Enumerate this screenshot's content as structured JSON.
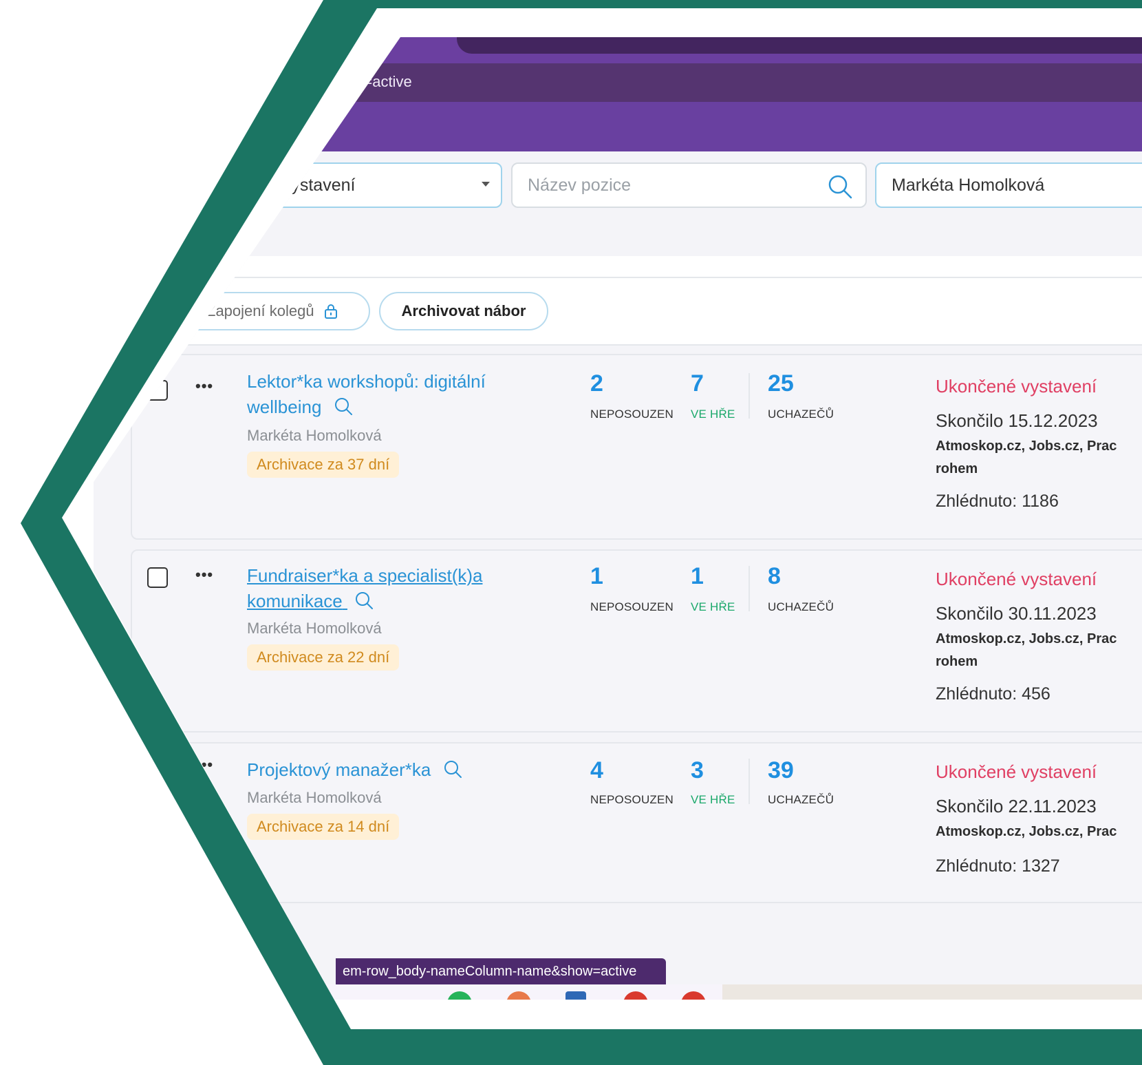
{
  "browser": {
    "url_fragment": "how=active",
    "status_url": "em-row_body-nameColumn-name&show=active"
  },
  "filters": {
    "publication_select": "a vystavení",
    "position_placeholder": "Název pozice",
    "owner_value": "Markéta Homolková"
  },
  "actions": {
    "colleagues_label": "Zapojení kolegů",
    "archive_label": "Archivovat nábor"
  },
  "stat_labels": {
    "unreviewed": "NEPOSOUZEN",
    "in_game": "VE HŘE",
    "applicants": "UCHAZEČŮ"
  },
  "rows": [
    {
      "title_line1": "Lektor*ka workshopů: digitální",
      "title_line2": "wellbeing",
      "owner": "Markéta Homolková",
      "archive_badge": "Archivace za 37 dní",
      "unreviewed": "2",
      "in_game": "7",
      "applicants": "25",
      "status": "Ukončené vystavení",
      "ended": "Skončilo 15.12.2023",
      "portals_line1": "Atmoskop.cz, Jobs.cz, Prac",
      "portals_line2": "rohem",
      "views": "Zhlédnuto: 1186"
    },
    {
      "title_line1": "Fundraiser*ka a specialist(k)a",
      "title_line2": "komunikace",
      "owner": "Markéta Homolková",
      "archive_badge": "Archivace za 22 dní",
      "unreviewed": "1",
      "in_game": "1",
      "applicants": "8",
      "status": "Ukončené vystavení",
      "ended": "Skončilo 30.11.2023",
      "portals_line1": "Atmoskop.cz, Jobs.cz, Prac",
      "portals_line2": "rohem",
      "views": "Zhlédnuto: 456"
    },
    {
      "title_line1": "Projektový manažer*ka",
      "owner": "Markéta Homolková",
      "archive_badge": "Archivace za 14 dní",
      "unreviewed": "4",
      "in_game": "3",
      "applicants": "39",
      "status": "Ukončené vystavení",
      "ended": "Skončilo 22.11.2023",
      "portals_line1": "Atmoskop.cz, Jobs.cz, Prac",
      "views": "Zhlédnuto: 1327"
    }
  ],
  "colors": {
    "frame_green": "#1b7563",
    "accent_purple": "#6940a0",
    "link_blue": "#2a93d5",
    "status_red": "#e03f63",
    "in_game_green": "#1aa86a"
  }
}
